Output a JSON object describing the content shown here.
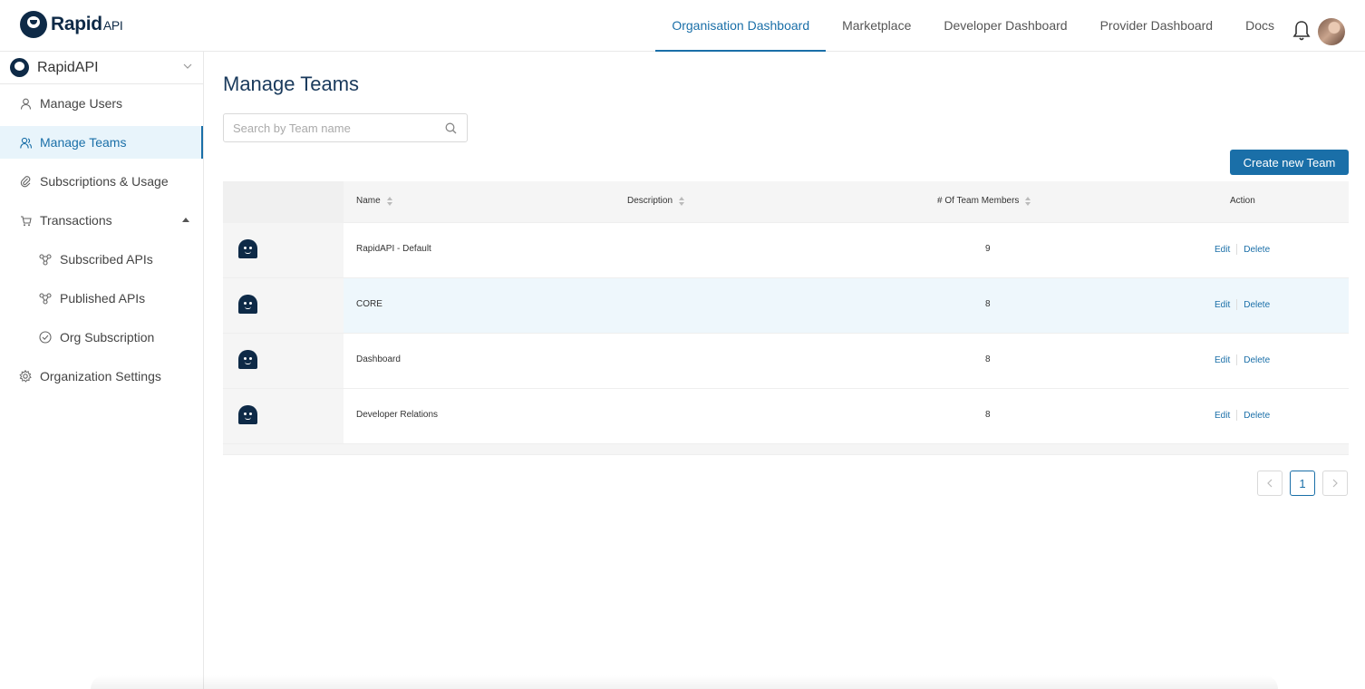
{
  "brand": {
    "name": "Rapid",
    "suffix": "API"
  },
  "nav": {
    "items": [
      {
        "label": "Organisation Dashboard",
        "active": true
      },
      {
        "label": "Marketplace",
        "active": false
      },
      {
        "label": "Developer Dashboard",
        "active": false
      },
      {
        "label": "Provider Dashboard",
        "active": false
      },
      {
        "label": "Docs",
        "active": false
      }
    ]
  },
  "sidebar": {
    "org_name": "RapidAPI",
    "items": [
      {
        "label": "Manage Users",
        "icon": "user-icon"
      },
      {
        "label": "Manage Teams",
        "icon": "team-icon",
        "active": true
      },
      {
        "label": "Subscriptions & Usage",
        "icon": "link-icon"
      },
      {
        "label": "Transactions",
        "icon": "cart-icon",
        "expanded": true
      },
      {
        "label": "Subscribed APIs",
        "icon": "api-icon"
      },
      {
        "label": "Published APIs",
        "icon": "api-icon"
      },
      {
        "label": "Org Subscription",
        "icon": "check-circle-icon"
      },
      {
        "label": "Organization Settings",
        "icon": "gear-icon"
      }
    ]
  },
  "main": {
    "title": "Manage Teams",
    "search_placeholder": "Search by Team name",
    "create_button": "Create new Team",
    "columns": {
      "name": "Name",
      "description": "Description",
      "members": "# Of Team Members",
      "action": "Action"
    },
    "rows": [
      {
        "name": "RapidAPI - Default",
        "description": "",
        "members": "9",
        "highlighted": false
      },
      {
        "name": "CORE",
        "description": "",
        "members": "8",
        "highlighted": true
      },
      {
        "name": "Dashboard",
        "description": "",
        "members": "8",
        "highlighted": false
      },
      {
        "name": "Developer Relations",
        "description": "",
        "members": "8",
        "highlighted": false
      }
    ],
    "edit_label": "Edit",
    "delete_label": "Delete",
    "pagination": {
      "current_page": "1"
    }
  },
  "colors": {
    "accent": "#1a6fa8",
    "brand_dark": "#0e2a47",
    "highlight_row": "#eef7fc"
  }
}
